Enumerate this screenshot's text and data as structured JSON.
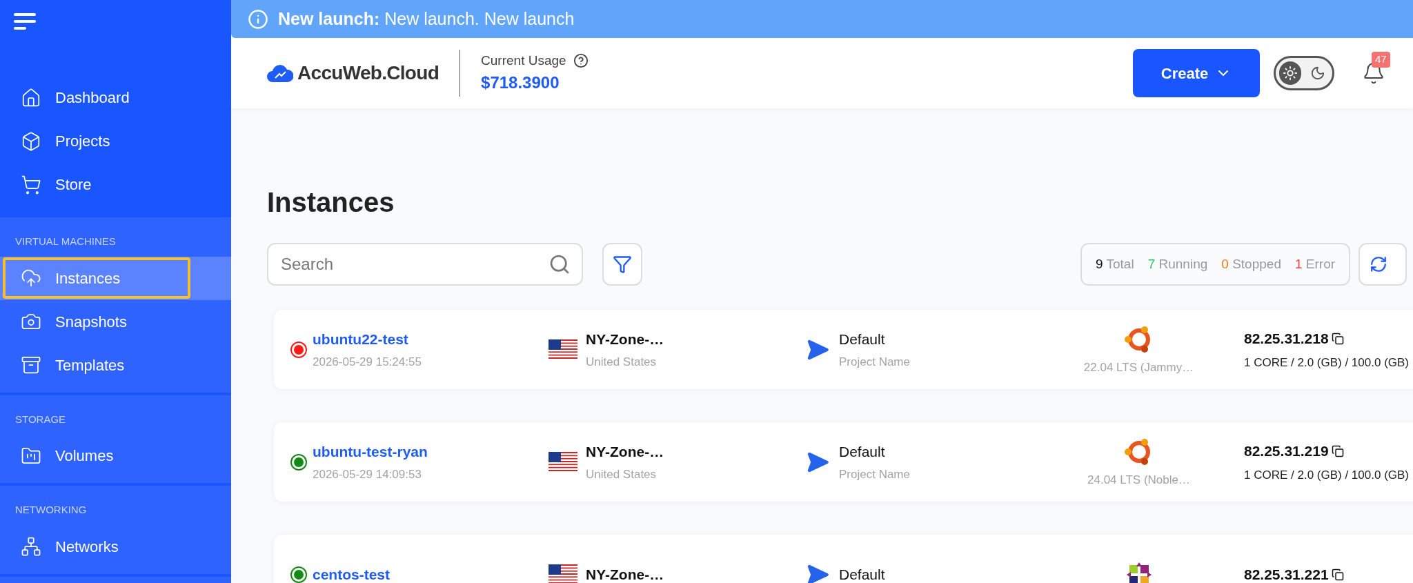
{
  "banner": {
    "title": "New launch:",
    "text": "New launch. New launch"
  },
  "sidebar": {
    "groups": [
      {
        "items": [
          {
            "label": "Dashboard",
            "selected": false
          },
          {
            "label": "Projects",
            "selected": false
          },
          {
            "label": "Store",
            "selected": false
          }
        ]
      },
      {
        "heading": "VIRTUAL MACHINES",
        "items": [
          {
            "label": "Instances",
            "selected": true
          },
          {
            "label": "Snapshots",
            "selected": false
          },
          {
            "label": "Templates",
            "selected": false
          }
        ]
      },
      {
        "heading": "STORAGE",
        "items": [
          {
            "label": "Volumes",
            "selected": false
          }
        ]
      },
      {
        "heading": "NETWORKING",
        "items": [
          {
            "label": "Networks",
            "selected": false
          }
        ]
      }
    ]
  },
  "header": {
    "logo": "AccuWeb.Cloud",
    "usage_label": "Current Usage",
    "usage_value": "$718.3900",
    "create_button": "Create",
    "dark_mode": false,
    "notifications": "47"
  },
  "page": {
    "title": "Instances",
    "search": {
      "placeholder": "Search"
    },
    "stats": [
      {
        "count": "9",
        "label": "Total",
        "color": "#111111"
      },
      {
        "count": "7",
        "label": "Running",
        "color": "#22c55e"
      },
      {
        "count": "0",
        "label": "Stopped",
        "color": "#f97316"
      },
      {
        "count": "1",
        "label": "Error",
        "color": "#ef4444"
      }
    ],
    "instances": [
      {
        "name": "ubuntu22-test",
        "created": "2026-05-29 15:24:55",
        "color": "#ff1a1a",
        "zone": "NY-Zone-…",
        "country": "United States",
        "project": "Default",
        "project_label": "Project Name",
        "kind": "ubuntu",
        "os_version": "22.04 LTS (Jammy…",
        "ip": "82.25.31.218",
        "specs": "1 CORE / 2.0 (GB) / 100.0 (GB)"
      },
      {
        "name": "ubuntu-test-ryan",
        "created": "2026-05-29 14:09:53",
        "color": "#138a13",
        "zone": "NY-Zone-…",
        "country": "United States",
        "project": "Default",
        "project_label": "Project Name",
        "kind": "ubuntu",
        "os_version": "24.04 LTS (Noble…",
        "ip": "82.25.31.219",
        "specs": "1 CORE / 2.0 (GB) / 100.0 (GB)"
      },
      {
        "name": "centos-test",
        "color": "#138a13",
        "zone": "NY-Zone-…",
        "project": "Default",
        "kind": "centos",
        "ip": "82.25.31.221"
      }
    ]
  }
}
